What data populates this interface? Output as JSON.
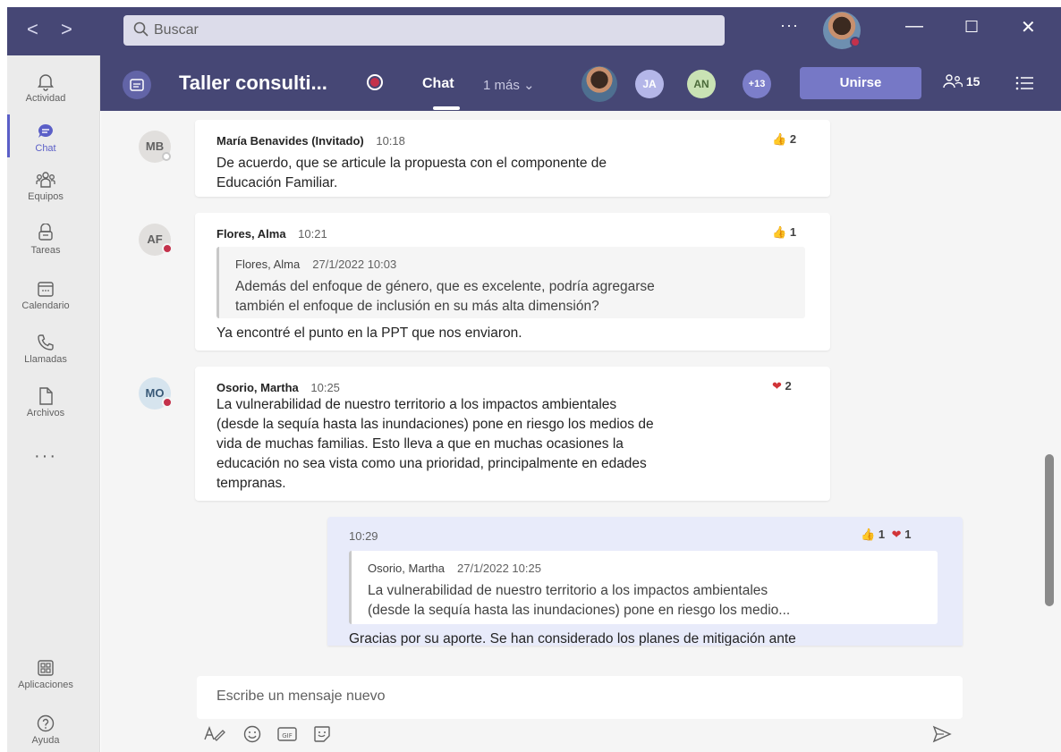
{
  "titlebar": {
    "back_label": "<",
    "forward_label": ">",
    "search_placeholder": "Buscar",
    "more_label": "···",
    "minimize_label": "—",
    "maximize_label": "☐",
    "close_label": "✕"
  },
  "rail": {
    "items": [
      {
        "label": "Actividad",
        "icon": "bell-icon"
      },
      {
        "label": "Chat",
        "icon": "chat-icon"
      },
      {
        "label": "Equipos",
        "icon": "teams-icon"
      },
      {
        "label": "Tareas",
        "icon": "tasks-icon"
      },
      {
        "label": "Calendario",
        "icon": "calendar-icon"
      },
      {
        "label": "Llamadas",
        "icon": "phone-icon"
      },
      {
        "label": "Archivos",
        "icon": "file-icon"
      }
    ],
    "more_label": "···",
    "apps_label": "Aplicaciones",
    "help_label": "Ayuda"
  },
  "meeting": {
    "title": "Taller consulti...",
    "chat_tab": "Chat",
    "more_tabs": "1 más ⌄",
    "avatars": [
      "JA",
      "AN",
      "+13"
    ],
    "join_label": "Unirse",
    "people_count": "15"
  },
  "messages": [
    {
      "initials": "MB",
      "sender": "María Benavides (Invitado)",
      "time": "10:18",
      "reaction_count": "2",
      "lines": [
        "De acuerdo, que se articule la propuesta con el componente de",
        "Educación Familiar."
      ]
    },
    {
      "initials": "AF",
      "sender": "Flores, Alma",
      "time": "10:21",
      "reaction_count": "1",
      "quote": {
        "sender": "Flores, Alma",
        "time": "27/1/2022 10:03",
        "lines": [
          "Además del enfoque de género, que es excelente, podría agregarse",
          "también el enfoque de inclusión en su más alta dimensión?"
        ]
      },
      "lines": [
        "Ya encontré el punto en la PPT que nos enviaron."
      ]
    },
    {
      "initials": "MO",
      "sender": "Osorio, Martha",
      "time": "10:25",
      "reaction_count": "2",
      "lines": [
        "La vulnerabilidad de nuestro territorio a los impactos ambientales",
        "(desde la sequía hasta las inundaciones) pone en riesgo los medios de",
        "vida de muchas familias. Esto lleva a que en muchas ocasiones la",
        "educación no sea vista como una prioridad, principalmente en edades",
        "tempranas."
      ]
    },
    {
      "time": "10:29",
      "like_count": "1",
      "heart_count": "1",
      "quote": {
        "sender": "Osorio, Martha",
        "time": "27/1/2022 10:25",
        "lines": [
          "La vulnerabilidad de nuestro territorio a los impactos ambientales",
          "(desde la sequía hasta las inundaciones) pone en riesgo los medio..."
        ]
      },
      "lines": [
        "Gracias por su aporte. Se han considerado los planes de mitigación ante"
      ]
    }
  ],
  "compose": {
    "placeholder": "Escribe un mensaje nuevo"
  },
  "colors": {
    "titlebar": "#464775",
    "accent": "#5b5fc7",
    "join": "#7678c6",
    "status_busy": "#c4314b"
  }
}
